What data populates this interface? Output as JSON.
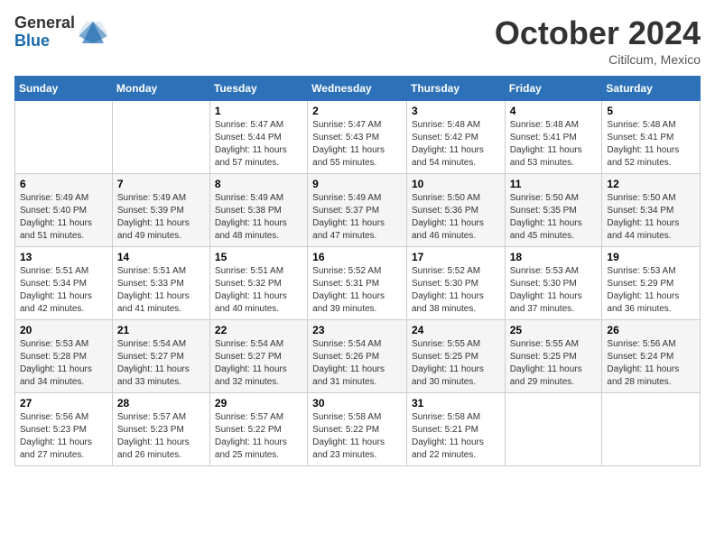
{
  "logo": {
    "general": "General",
    "blue": "Blue"
  },
  "title": "October 2024",
  "location": "Citilcum, Mexico",
  "days_header": [
    "Sunday",
    "Monday",
    "Tuesday",
    "Wednesday",
    "Thursday",
    "Friday",
    "Saturday"
  ],
  "weeks": [
    [
      {
        "day": "",
        "info": ""
      },
      {
        "day": "",
        "info": ""
      },
      {
        "day": "1",
        "info": "Sunrise: 5:47 AM\nSunset: 5:44 PM\nDaylight: 11 hours and 57 minutes."
      },
      {
        "day": "2",
        "info": "Sunrise: 5:47 AM\nSunset: 5:43 PM\nDaylight: 11 hours and 55 minutes."
      },
      {
        "day": "3",
        "info": "Sunrise: 5:48 AM\nSunset: 5:42 PM\nDaylight: 11 hours and 54 minutes."
      },
      {
        "day": "4",
        "info": "Sunrise: 5:48 AM\nSunset: 5:41 PM\nDaylight: 11 hours and 53 minutes."
      },
      {
        "day": "5",
        "info": "Sunrise: 5:48 AM\nSunset: 5:41 PM\nDaylight: 11 hours and 52 minutes."
      }
    ],
    [
      {
        "day": "6",
        "info": "Sunrise: 5:49 AM\nSunset: 5:40 PM\nDaylight: 11 hours and 51 minutes."
      },
      {
        "day": "7",
        "info": "Sunrise: 5:49 AM\nSunset: 5:39 PM\nDaylight: 11 hours and 49 minutes."
      },
      {
        "day": "8",
        "info": "Sunrise: 5:49 AM\nSunset: 5:38 PM\nDaylight: 11 hours and 48 minutes."
      },
      {
        "day": "9",
        "info": "Sunrise: 5:49 AM\nSunset: 5:37 PM\nDaylight: 11 hours and 47 minutes."
      },
      {
        "day": "10",
        "info": "Sunrise: 5:50 AM\nSunset: 5:36 PM\nDaylight: 11 hours and 46 minutes."
      },
      {
        "day": "11",
        "info": "Sunrise: 5:50 AM\nSunset: 5:35 PM\nDaylight: 11 hours and 45 minutes."
      },
      {
        "day": "12",
        "info": "Sunrise: 5:50 AM\nSunset: 5:34 PM\nDaylight: 11 hours and 44 minutes."
      }
    ],
    [
      {
        "day": "13",
        "info": "Sunrise: 5:51 AM\nSunset: 5:34 PM\nDaylight: 11 hours and 42 minutes."
      },
      {
        "day": "14",
        "info": "Sunrise: 5:51 AM\nSunset: 5:33 PM\nDaylight: 11 hours and 41 minutes."
      },
      {
        "day": "15",
        "info": "Sunrise: 5:51 AM\nSunset: 5:32 PM\nDaylight: 11 hours and 40 minutes."
      },
      {
        "day": "16",
        "info": "Sunrise: 5:52 AM\nSunset: 5:31 PM\nDaylight: 11 hours and 39 minutes."
      },
      {
        "day": "17",
        "info": "Sunrise: 5:52 AM\nSunset: 5:30 PM\nDaylight: 11 hours and 38 minutes."
      },
      {
        "day": "18",
        "info": "Sunrise: 5:53 AM\nSunset: 5:30 PM\nDaylight: 11 hours and 37 minutes."
      },
      {
        "day": "19",
        "info": "Sunrise: 5:53 AM\nSunset: 5:29 PM\nDaylight: 11 hours and 36 minutes."
      }
    ],
    [
      {
        "day": "20",
        "info": "Sunrise: 5:53 AM\nSunset: 5:28 PM\nDaylight: 11 hours and 34 minutes."
      },
      {
        "day": "21",
        "info": "Sunrise: 5:54 AM\nSunset: 5:27 PM\nDaylight: 11 hours and 33 minutes."
      },
      {
        "day": "22",
        "info": "Sunrise: 5:54 AM\nSunset: 5:27 PM\nDaylight: 11 hours and 32 minutes."
      },
      {
        "day": "23",
        "info": "Sunrise: 5:54 AM\nSunset: 5:26 PM\nDaylight: 11 hours and 31 minutes."
      },
      {
        "day": "24",
        "info": "Sunrise: 5:55 AM\nSunset: 5:25 PM\nDaylight: 11 hours and 30 minutes."
      },
      {
        "day": "25",
        "info": "Sunrise: 5:55 AM\nSunset: 5:25 PM\nDaylight: 11 hours and 29 minutes."
      },
      {
        "day": "26",
        "info": "Sunrise: 5:56 AM\nSunset: 5:24 PM\nDaylight: 11 hours and 28 minutes."
      }
    ],
    [
      {
        "day": "27",
        "info": "Sunrise: 5:56 AM\nSunset: 5:23 PM\nDaylight: 11 hours and 27 minutes."
      },
      {
        "day": "28",
        "info": "Sunrise: 5:57 AM\nSunset: 5:23 PM\nDaylight: 11 hours and 26 minutes."
      },
      {
        "day": "29",
        "info": "Sunrise: 5:57 AM\nSunset: 5:22 PM\nDaylight: 11 hours and 25 minutes."
      },
      {
        "day": "30",
        "info": "Sunrise: 5:58 AM\nSunset: 5:22 PM\nDaylight: 11 hours and 23 minutes."
      },
      {
        "day": "31",
        "info": "Sunrise: 5:58 AM\nSunset: 5:21 PM\nDaylight: 11 hours and 22 minutes."
      },
      {
        "day": "",
        "info": ""
      },
      {
        "day": "",
        "info": ""
      }
    ]
  ]
}
